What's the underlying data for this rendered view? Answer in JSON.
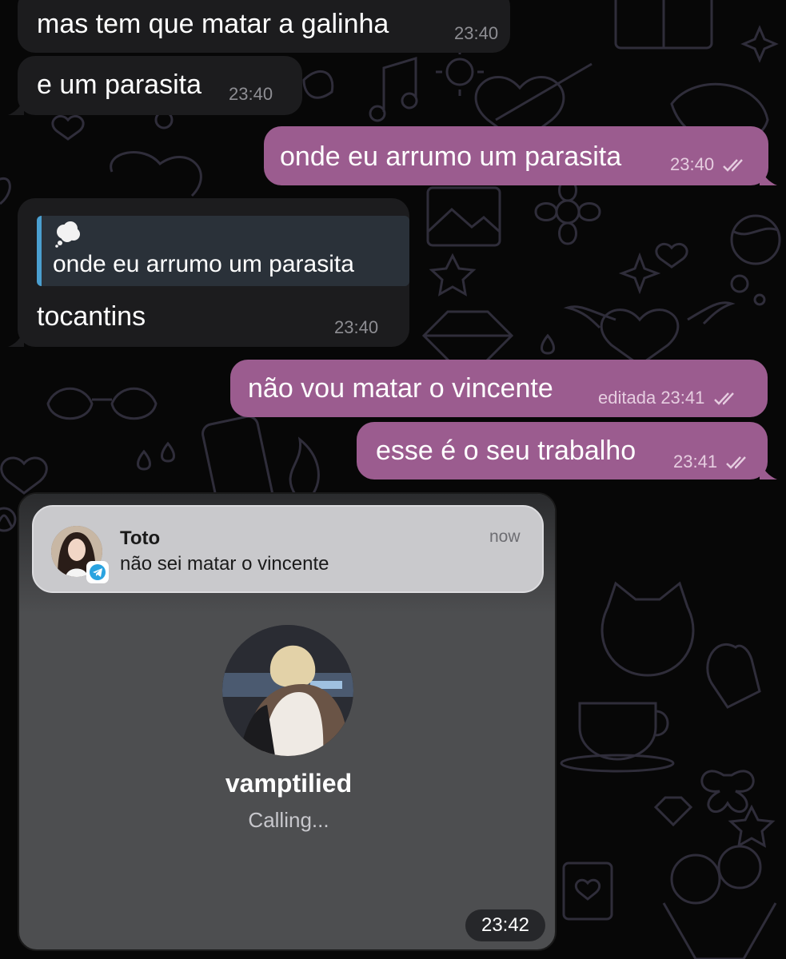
{
  "messages": [
    {
      "id": "m1",
      "direction": "incoming",
      "text": "mas tem que matar a galinha",
      "time": "23:40"
    },
    {
      "id": "m2",
      "direction": "incoming",
      "text": "e um parasita",
      "time": "23:40"
    },
    {
      "id": "m3",
      "direction": "outgoing",
      "text": "onde eu arrumo um parasita",
      "time": "23:40",
      "read": true
    },
    {
      "id": "m4",
      "direction": "incoming",
      "reply_icon": "thought-balloon-icon",
      "reply_text": "onde eu arrumo um parasita",
      "text": "tocantins",
      "time": "23:40"
    },
    {
      "id": "m5",
      "direction": "outgoing",
      "text": "não vou matar o vincente",
      "edited_label": "editada",
      "time": "23:41",
      "read": true
    },
    {
      "id": "m6",
      "direction": "outgoing",
      "text": "esse é o seu trabalho",
      "time": "23:41",
      "read": true
    },
    {
      "id": "m7",
      "direction": "incoming",
      "type": "image",
      "time": "23:42"
    }
  ],
  "image_content": {
    "notification": {
      "sender": "Toto",
      "message": "não sei matar o vincente",
      "time": "now",
      "app_badge": "telegram-icon"
    },
    "call": {
      "name": "vamptilied",
      "status": "Calling..."
    }
  },
  "colors": {
    "background": "#070707",
    "incoming_bubble": "#1c1c1e",
    "outgoing_bubble": "#9b5c8f",
    "reply_accent": "#4a9fd0",
    "doodle_stroke": "#2f2d3a"
  }
}
